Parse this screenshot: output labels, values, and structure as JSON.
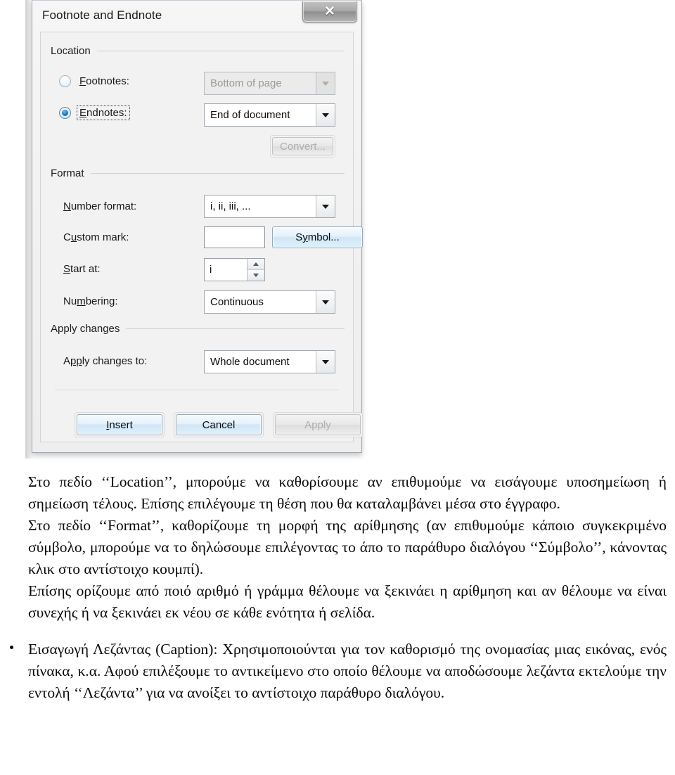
{
  "dialog": {
    "title": "Footnote and Endnote",
    "close_label": "✕",
    "groups": {
      "location": {
        "heading": "Location",
        "footnotes_radio_label": "Footnotes:",
        "footnotes_value": "Bottom of page",
        "footnotes_enabled": false,
        "footnotes_selected": false,
        "endnotes_radio_label": "Endnotes:",
        "endnotes_value": "End of document",
        "endnotes_enabled": true,
        "endnotes_selected": true,
        "convert_button": "Convert...",
        "convert_enabled": false
      },
      "format": {
        "heading": "Format",
        "number_format_label": "Number format:",
        "number_format_value": "i, ii, iii, ...",
        "custom_mark_label": "Custom mark:",
        "custom_mark_value": "",
        "symbol_button": "Symbol...",
        "start_at_label": "Start at:",
        "start_at_value": "i",
        "numbering_label": "Numbering:",
        "numbering_value": "Continuous"
      },
      "apply_changes": {
        "heading": "Apply changes",
        "apply_to_label": "Apply changes to:",
        "apply_to_value": "Whole document"
      }
    },
    "buttons": {
      "insert": "Insert",
      "cancel": "Cancel",
      "apply": "Apply",
      "apply_enabled": false
    }
  },
  "document_text": {
    "paragraph_1": "Στο πεδίο ‘‘Location’’, μπορούμε να καθορίσουμε αν επιθυμούμε να εισάγουμε υποσημείωση ή σημείωση τέλους. Επίσης επιλέγουμε τη θέση που θα καταλαμβάνει μέσα στο έγγραφο.",
    "paragraph_2": "Στο πεδίο ‘‘Format’’, καθορίζουμε τη μορφή της αρίθμησης (αν επιθυμούμε κάποιο συγκεκριμένο σύμβολο, μπορούμε να το δηλώσουμε επιλέγοντας το άπο το παράθυρο διαλόγου ‘‘Σύμβολο’’, κάνοντας κλικ στο αντίστοιχο κουμπί).",
    "paragraph_3": "Επίσης ορίζουμε από ποιό αριθμό ή γράμμα θέλουμε να ξεκινάει η αρίθμηση και αν θέλουμε να είναι συνεχής ή να ξεκινάει εκ νέου σε κάθε ενότητα ή σελίδα.",
    "bullet_paragraph": "Εισαγωγή Λεζάντας (Caption): Χρησιμοποιούνται για τον καθορισμό της ονομασίας μιας εικόνας, ενός πίνακα, κ.α. Αφού επιλέξουμε το αντικείμενο στο οποίο θέλουμε να αποδώσουμε λεζάντα εκτελούμε την εντολή ‘‘Λεζάντα’’ για να ανοίξει το αντίστοιχο παράθυρο διαλόγου."
  },
  "colors": {
    "dialog_background": "#f0f0f0",
    "selected_radio": "#1a72c0",
    "button_accent": "#cfe6f7",
    "disabled_text": "#9a9a9a"
  }
}
